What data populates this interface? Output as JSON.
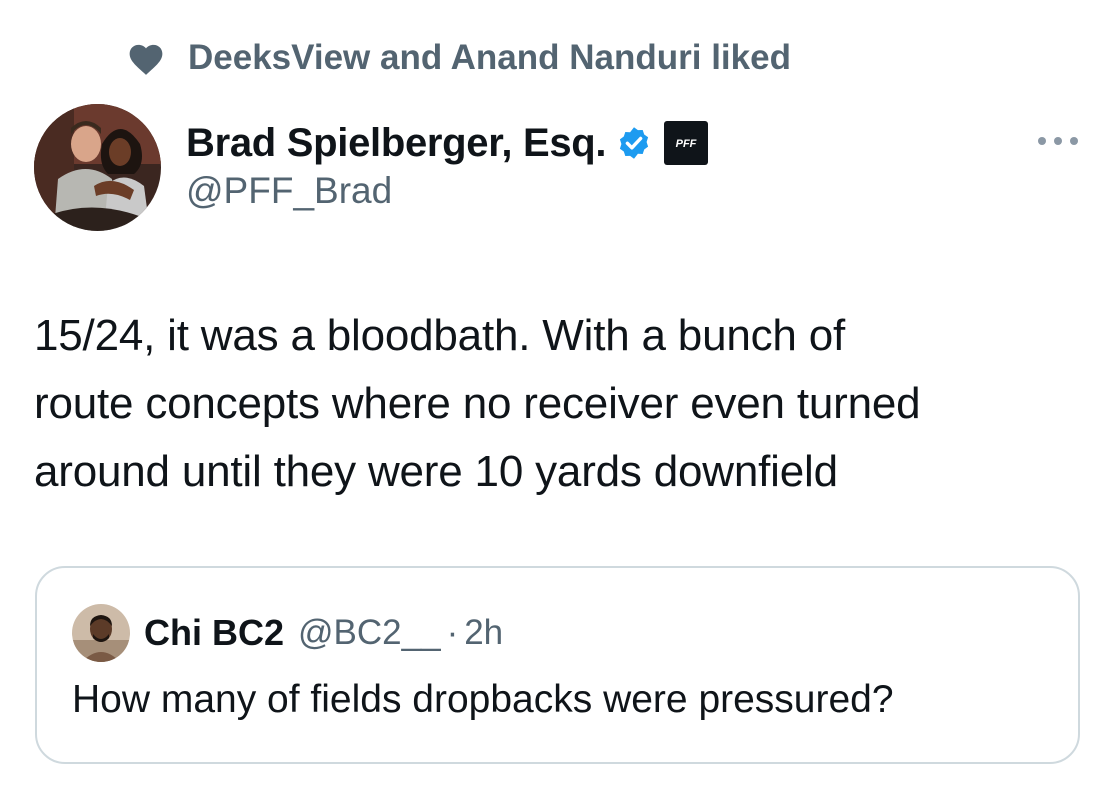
{
  "social_context": {
    "icon": "heart-icon",
    "text": "DeeksView and Anand Nanduri liked"
  },
  "author": {
    "display_name": "Brad Spielberger, Esq.",
    "handle": "@PFF_Brad",
    "verified_icon": "verified-badge-icon",
    "affiliation_badge_text": "PFF",
    "avatar_icon": "profile-photo-couple"
  },
  "more_icon": "more-horizontal-icon",
  "tweet": {
    "lines": [
      "15/24, it was a bloodbath. With a bunch of",
      "route concepts where no receiver even turned",
      "around until they were 10 yards downfield"
    ]
  },
  "quoted_tweet": {
    "display_name": "Chi BC2",
    "handle": "@BC2__",
    "separator": "·",
    "time": "2h",
    "text": "How many of fields dropbacks were pressured?",
    "avatar_icon": "profile-photo-man"
  },
  "colors": {
    "primary_text": "#0f1419",
    "secondary_text": "#536471",
    "verified_blue": "#1d9bf0",
    "card_border": "#cfd9de",
    "background": "#ffffff"
  }
}
